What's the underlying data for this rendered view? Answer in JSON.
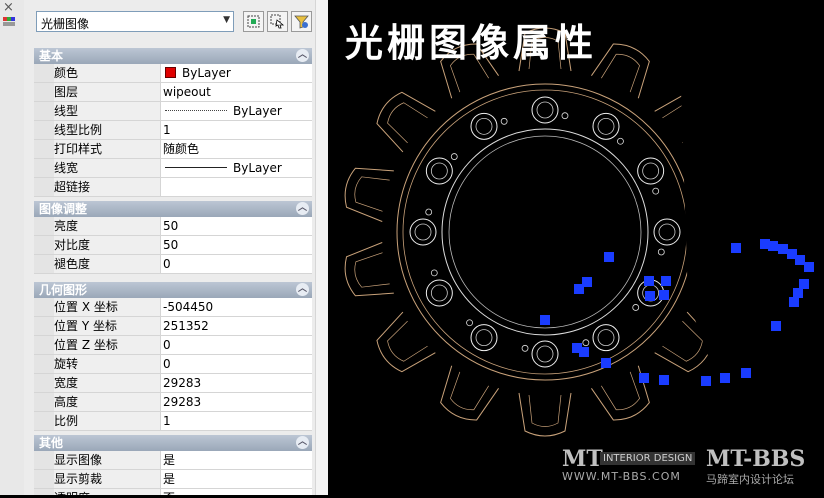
{
  "palette": {
    "object_type": "光栅图像",
    "sections": [
      {
        "title": "基本",
        "rows": [
          {
            "label": "颜色",
            "value": "ByLayer",
            "kind": "color"
          },
          {
            "label": "图层",
            "value": "wipeout"
          },
          {
            "label": "线型",
            "value": "ByLayer",
            "kind": "linetype-dashed"
          },
          {
            "label": "线型比例",
            "value": "1"
          },
          {
            "label": "打印样式",
            "value": "随颜色"
          },
          {
            "label": "线宽",
            "value": "ByLayer",
            "kind": "linetype-solid"
          },
          {
            "label": "超链接",
            "value": ""
          }
        ]
      },
      {
        "title": "图像调整",
        "rows": [
          {
            "label": "亮度",
            "value": "50"
          },
          {
            "label": "对比度",
            "value": "50"
          },
          {
            "label": "褪色度",
            "value": "0"
          }
        ]
      },
      {
        "title": "几何图形",
        "rows": [
          {
            "label": "位置 X 坐标",
            "value": "-504450"
          },
          {
            "label": "位置 Y 坐标",
            "value": "251352"
          },
          {
            "label": "位置 Z 坐标",
            "value": "0"
          },
          {
            "label": "旋转",
            "value": "0"
          },
          {
            "label": "宽度",
            "value": "29283"
          },
          {
            "label": "高度",
            "value": "29283"
          },
          {
            "label": "比例",
            "value": "1"
          }
        ]
      },
      {
        "title": "其他",
        "rows": [
          {
            "label": "显示图像",
            "value": "是"
          },
          {
            "label": "显示剪裁",
            "value": "是"
          },
          {
            "label": "透明度",
            "value": "否"
          }
        ]
      }
    ]
  },
  "canvas": {
    "title": "光栅图像属性",
    "watermark": {
      "brand": "MT",
      "tag": "INTERIOR DESIGN",
      "brand2": "MT-BBS",
      "url": "WWW.MT-BBS.COM",
      "tagline": "马蹄室内设计论坛"
    }
  },
  "colors": {
    "accent_grip": "#1a3cff",
    "drawing_lines": "#c9a27a",
    "layer_color": "#e00000"
  }
}
